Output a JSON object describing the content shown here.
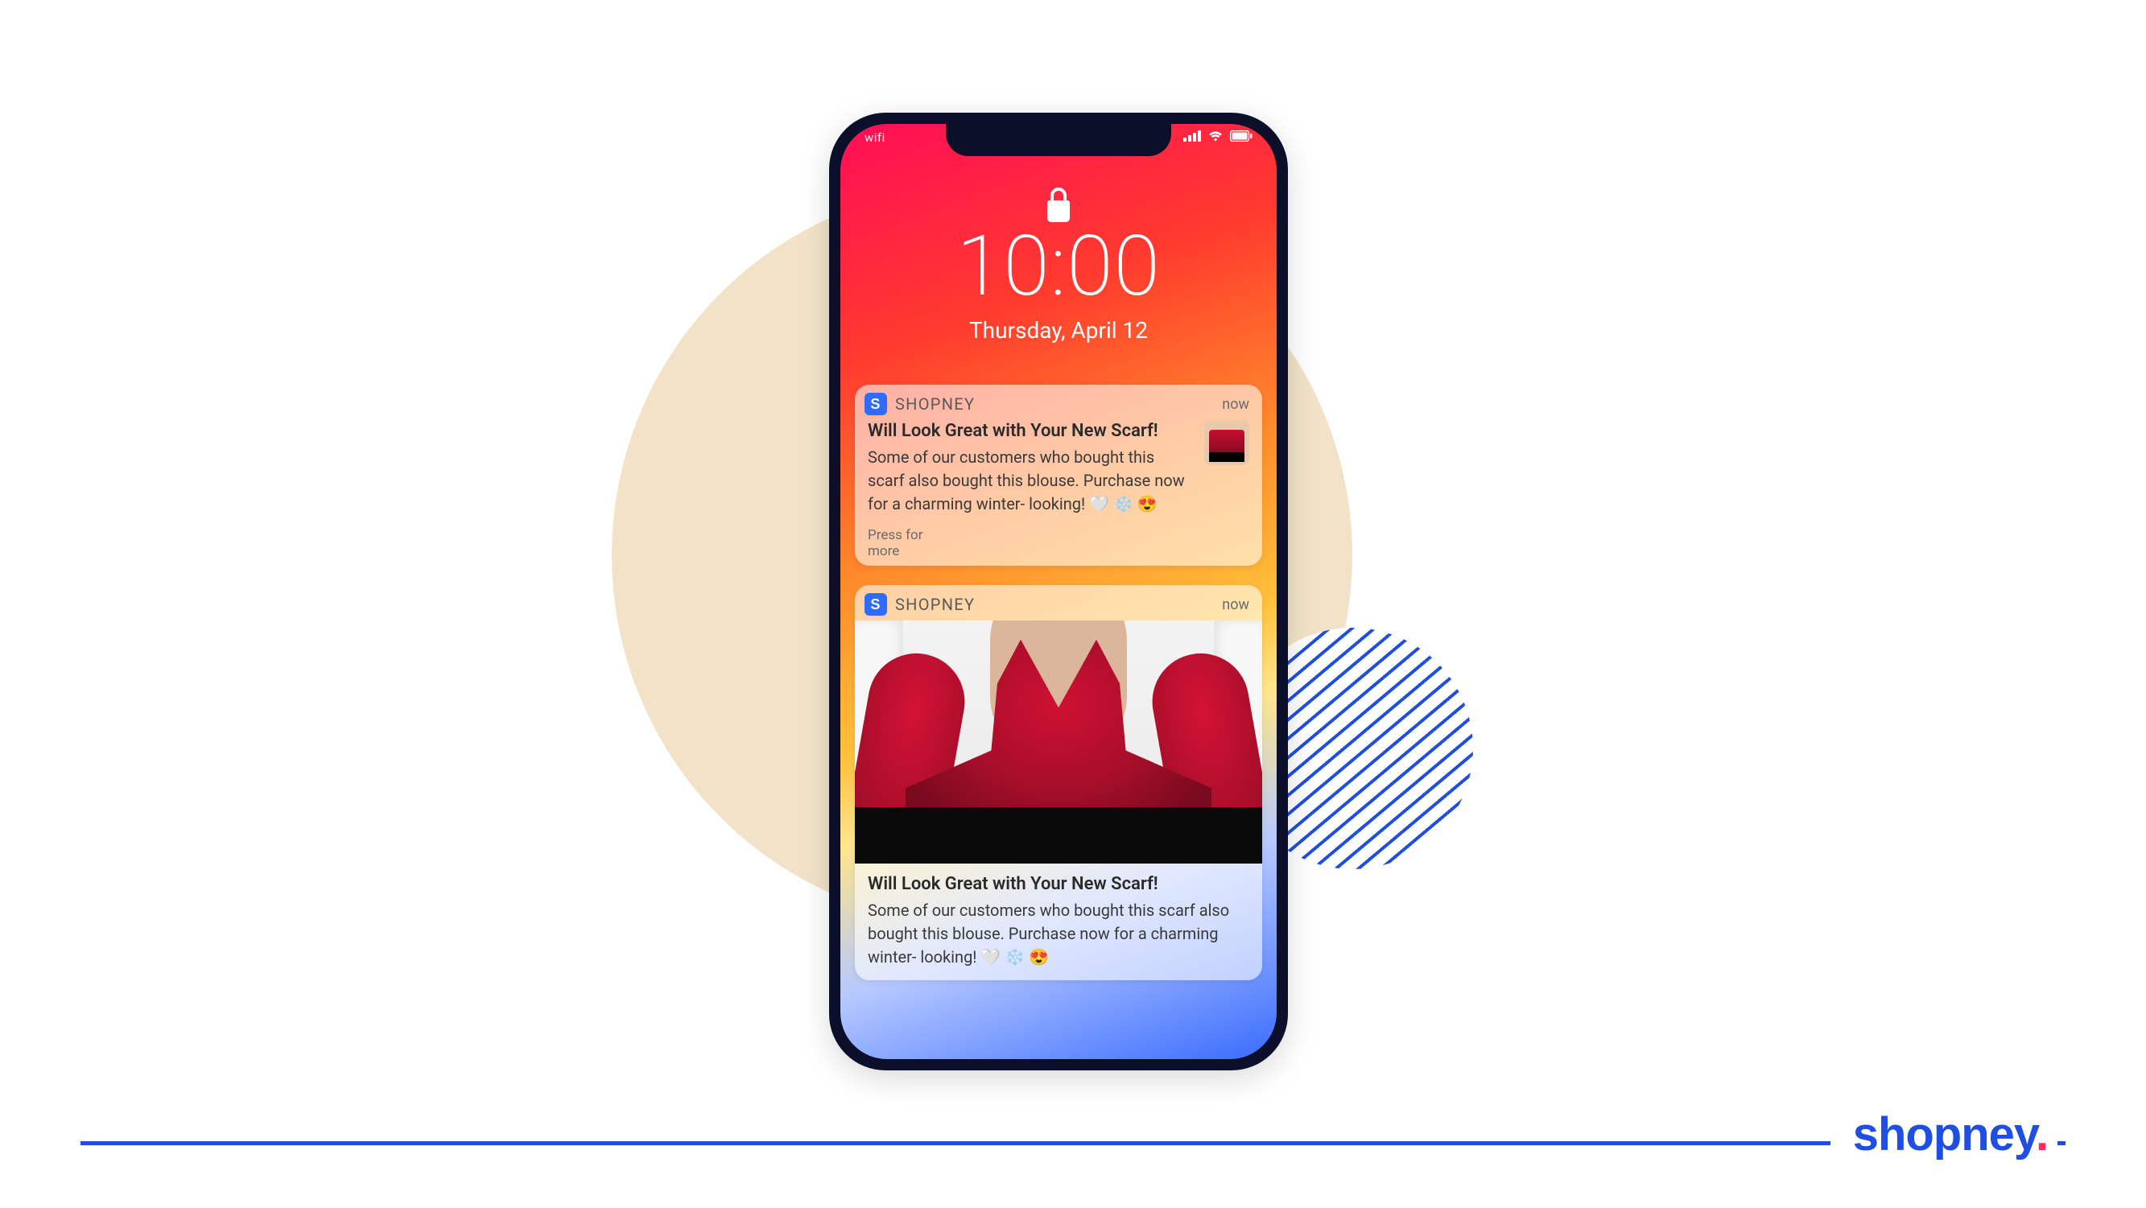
{
  "colors": {
    "accent_blue": "#1f4ee3",
    "accent_red": "#ff2d55",
    "phone_frame": "#0b0f2a",
    "beige": "#f2e3c8"
  },
  "brand": {
    "name": "shopney",
    "dot": "."
  },
  "lockscreen": {
    "status_left": "wifi",
    "clock": "10:00",
    "date": "Thursday, April 12"
  },
  "notifications": {
    "n1": {
      "app_badge": "S",
      "app_name": "SHOPNEY",
      "time": "now",
      "title": "Will Look Great with Your New Scarf!",
      "body": "Some of our customers who bought this scarf also bought this blouse. Purchase now for a charming winter- looking! 🤍 ❄️ 😍",
      "press_line1": "Press for",
      "press_line2": "more",
      "thumb_alt": "red blouse product thumbnail"
    },
    "n2": {
      "app_badge": "S",
      "app_name": "SHOPNEY",
      "time": "now",
      "title": "Will Look Great with Your New Scarf!",
      "body": "Some of our customers who bought this scarf also bought this blouse. Purchase now for a charming winter- looking! 🤍 ❄️ 😍",
      "hero_alt": "model wearing red v-neck blouse"
    }
  }
}
